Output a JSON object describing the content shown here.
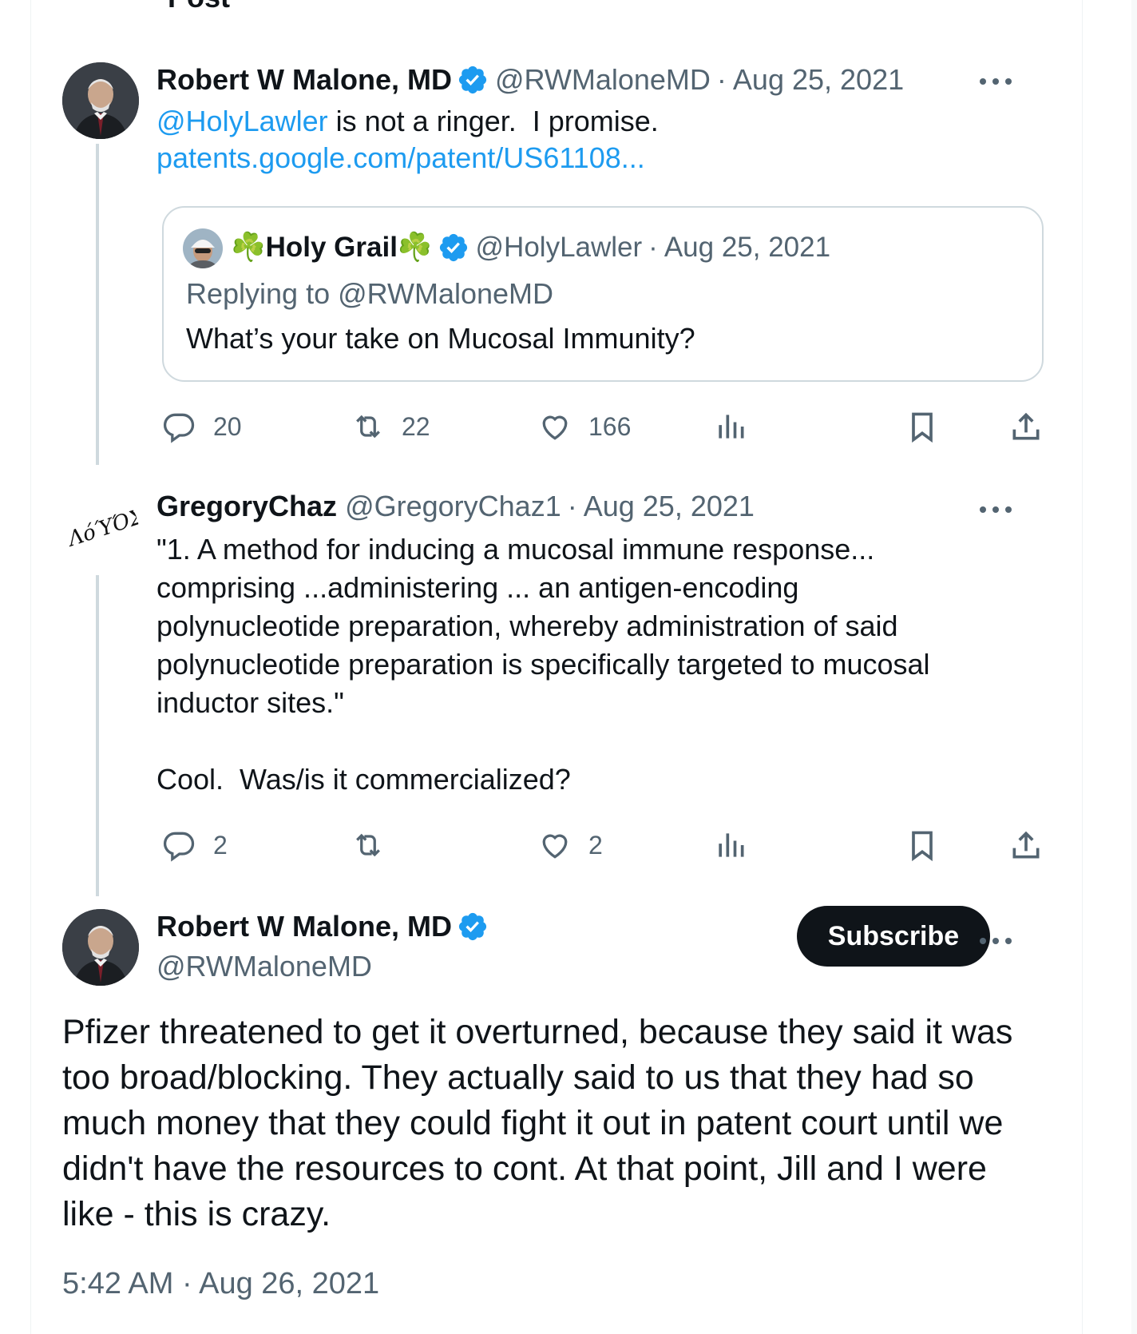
{
  "header": {
    "title": "Post",
    "back_icon": "arrow-left-icon"
  },
  "tweet1": {
    "author_name": "Robert W Malone, MD",
    "handle": "@RWMaloneMD",
    "separator": "·",
    "date": "Aug 25, 2021",
    "mention": "@HolyLawler",
    "text_rest": " is not a ringer.  I promise.",
    "link": "patents.google.com/patent/US61108...",
    "quote": {
      "author_name": "Holy Grail",
      "name_emoji": "☘️",
      "handle": "@HolyLawler",
      "separator": "·",
      "date": "Aug 25, 2021",
      "replying_to": "Replying to @RWMaloneMD",
      "text": "What’s your take on Mucosal Immunity?"
    },
    "actions": {
      "replies": "20",
      "reposts": "22",
      "likes": "166"
    }
  },
  "tweet2": {
    "author_name": "GregoryChaz",
    "avatar_text": "ΛόΎΌΣ",
    "handle": "@GregoryChaz1",
    "separator": "·",
    "date": "Aug 25, 2021",
    "text_lines": [
      "\"1. A method for inducing a mucosal immune response...",
      "comprising ...administering ... an antigen-encoding",
      "polynucleotide preparation, whereby administration of said",
      "polynucleotide preparation is specifically targeted to mucosal",
      "inductor sites.\""
    ],
    "text_last": "Cool.  Was/is it commercialized?",
    "actions": {
      "replies": "2",
      "reposts": "",
      "likes": "2"
    }
  },
  "tweet3": {
    "author_name": "Robert W Malone, MD",
    "handle": "@RWMaloneMD",
    "subscribe_label": "Subscribe",
    "text_lines": [
      "Pfizer threatened to get it overturned, because they said it was",
      "too broad/blocking. They actually said to us that they had so",
      "much money that they could fight it out in patent court until we",
      "didn't have the resources to cont. At that point, Jill and I were",
      "like - this is crazy."
    ],
    "timestamp": "5:42 AM · Aug 26, 2021"
  },
  "colors": {
    "accent": "#1d9bf0",
    "text": "#0f1419",
    "muted": "#536471",
    "border": "#cfd9de"
  }
}
